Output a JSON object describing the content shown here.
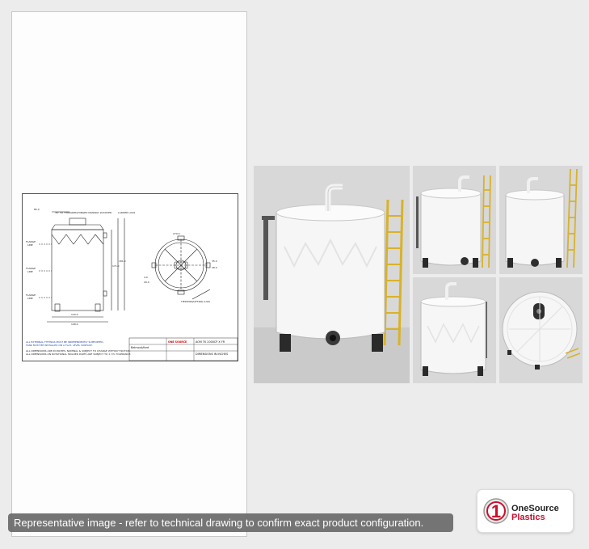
{
  "document": {
    "drawing": {
      "title_block": {
        "brand": "ONE SOURCE",
        "company": "Belmont/ford",
        "model": "AOM TK 2000CP X FR",
        "note_title": "DIMENSIONS IN INCHES"
      },
      "notes": [
        "ALL EXTERNAL FITTINGS MUST BE INDEPENDENTLY SUPPORTED.",
        "TANK MUST BE INSTALLED ON A FLAT, LEVEL SURFACE.",
        "ALL DIMENSIONS ARE IN INCHES, NOMINAL & SUBJECT TO CHANGE WITHOUT NOTICE.",
        "ALL DIMENSIONS ON ROTATIONAL MOLDED PARTS ARE SUBJECT TO ± 3% TOLERANCE."
      ],
      "labels": {
        "top_fitting": "85.0",
        "manway": "36\" FR THREADED/HINGED MANWAY W/COVER",
        "ladder_lugs": "LADDER LUGS",
        "flange": "FLANGE",
        "line": "LINE",
        "tiedown": "TIEDOWN/LIFTING LUGS",
        "plan_view": "270.0",
        "dim_1": "120.0",
        "dim_2": "108.0",
        "dim_3": "35.0",
        "dim_4": "28.0",
        "dim_5": "4.0",
        "dim_6": "29.0",
        "dim_7": "171.0",
        "dim_8": "181.0"
      }
    }
  },
  "photos": [
    {
      "name": "Main tank view with ladder"
    },
    {
      "name": "Tank front view"
    },
    {
      "name": "Tank side view with ladder"
    },
    {
      "name": "Tank rear view"
    },
    {
      "name": "Tank top view"
    }
  ],
  "logo": {
    "line1": "OneSource",
    "line2": "Plastics",
    "mark": "1",
    "accent_color": "#c8102e"
  },
  "caption": {
    "text": "Representative image - refer to technical drawing to confirm exact product configuration."
  }
}
